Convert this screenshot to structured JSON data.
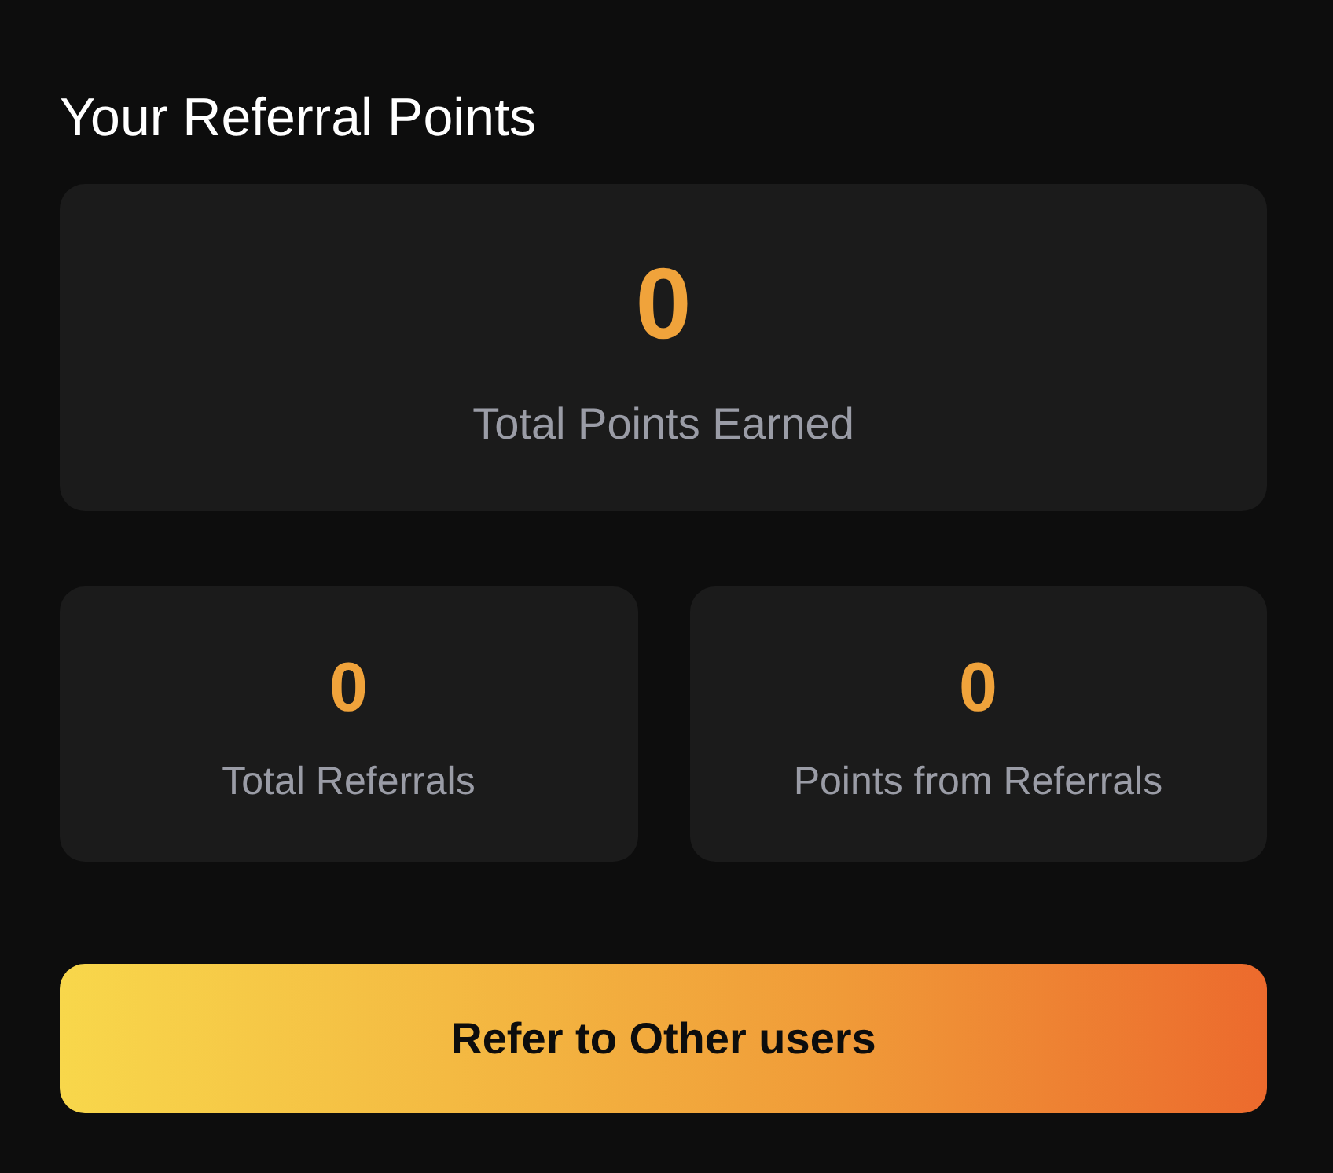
{
  "title": "Your Referral Points",
  "total": {
    "value": "0",
    "label": "Total Points Earned"
  },
  "stats": [
    {
      "value": "0",
      "label": "Total Referrals"
    },
    {
      "value": "0",
      "label": "Points from Referrals"
    }
  ],
  "button": {
    "label": "Refer to Other users"
  }
}
